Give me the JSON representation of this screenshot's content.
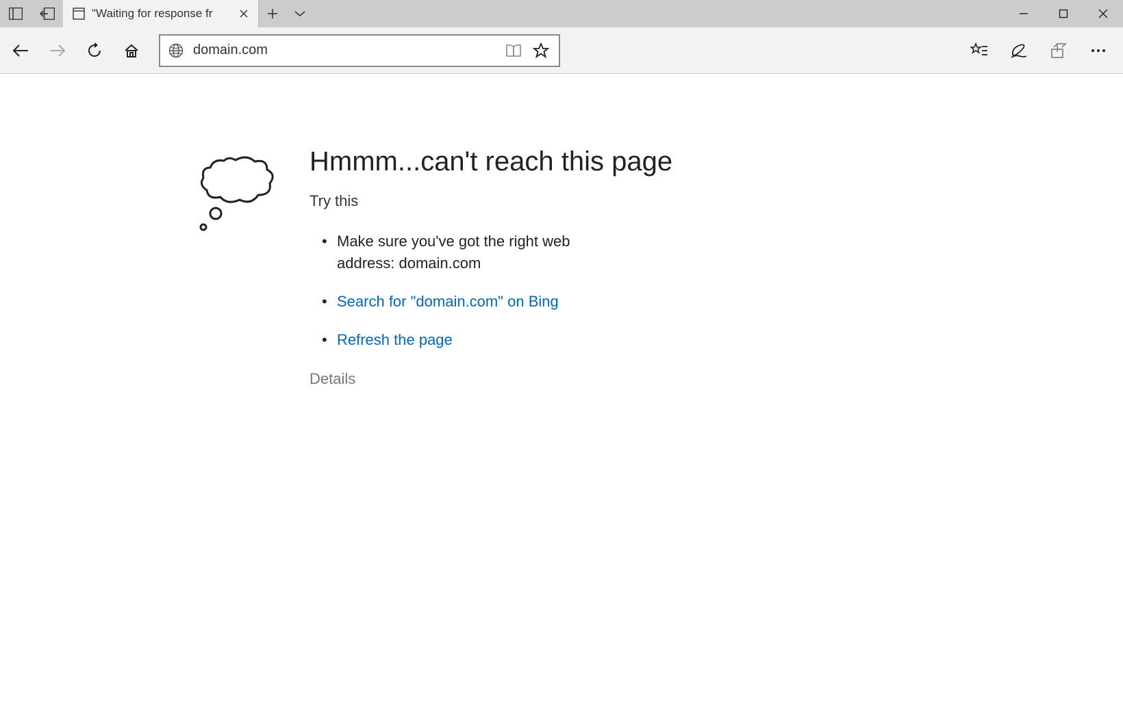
{
  "tab": {
    "title": "\"Waiting for response fr"
  },
  "address": {
    "url": "domain.com"
  },
  "error": {
    "headline": "Hmmm...can't reach this page",
    "try_this": "Try this",
    "items": [
      "Make sure you've got the right web address: domain.com",
      "Search for \"domain.com\" on Bing",
      "Refresh the page"
    ],
    "details": "Details"
  }
}
